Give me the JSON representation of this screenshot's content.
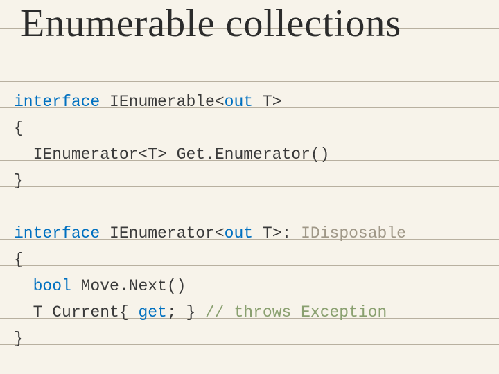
{
  "title": "Enumerable collections",
  "code": {
    "line1_a": "interface",
    "line1_b": " IEnumerable<",
    "line1_c": "out",
    "line1_d": " T>",
    "line2": "{",
    "line3": "  IEnumerator<T> Get.Enumerator()",
    "line4": "}",
    "blank": " ",
    "line5_a": "interface",
    "line5_b": " IEnumerator<",
    "line5_c": "out",
    "line5_d": " T>: ",
    "line5_e": "IDisposable",
    "line6": "{",
    "line7_a": "  ",
    "line7_b": "bool",
    "line7_c": " Move.Next()",
    "line8_a": "  T Current{ ",
    "line8_b": "get",
    "line8_c": "; } ",
    "line8_d": "// throws Exception",
    "line9": "}"
  }
}
